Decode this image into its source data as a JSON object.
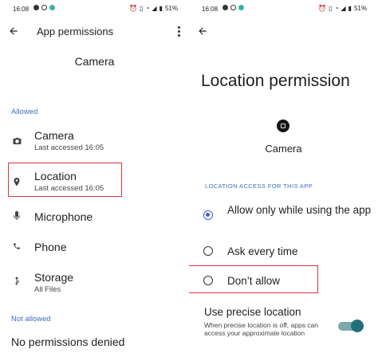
{
  "left": {
    "status_bar": {
      "time": "16:08",
      "battery": "51%",
      "icons": [
        "facebook-icon",
        "instagram-icon",
        "app-icon",
        "alarm-icon",
        "vibrate-icon",
        "wifi-icon",
        "signal-icon",
        "battery-icon"
      ]
    },
    "header": {
      "title": "App permissions"
    },
    "app_name": "Camera",
    "allowed_label": "Allowed",
    "allowed": [
      {
        "title": "Camera",
        "subtitle": "Last accessed 16:05",
        "icon": "camera-icon"
      },
      {
        "title": "Location",
        "subtitle": "Last accessed 16:05",
        "icon": "location-pin-icon"
      },
      {
        "title": "Microphone",
        "subtitle": "",
        "icon": "microphone-icon"
      },
      {
        "title": "Phone",
        "subtitle": "",
        "icon": "phone-icon"
      },
      {
        "title": "Storage",
        "subtitle": "All Files",
        "icon": "storage-icon"
      }
    ],
    "not_allowed_label": "Not allowed",
    "not_allowed_text": "No permissions denied"
  },
  "right": {
    "status_bar": {
      "time": "16:08",
      "battery": "51%"
    },
    "title": "Location permission",
    "app_name": "Camera",
    "section_label": "LOCATION ACCESS FOR THIS APP",
    "options": [
      {
        "label": "Allow only while using the app",
        "selected": true
      },
      {
        "label": "Ask every time",
        "selected": false
      },
      {
        "label": "Don’t allow",
        "selected": false
      }
    ],
    "precise": {
      "title": "Use precise location",
      "description": "When precise location is off, apps can access your approximate location",
      "enabled": true
    }
  },
  "colors": {
    "accent_blue": "#3d6fbf",
    "radio_selected": "#3e5ec7",
    "highlight_red": "#d9333f",
    "toggle_on": "#21717b"
  }
}
